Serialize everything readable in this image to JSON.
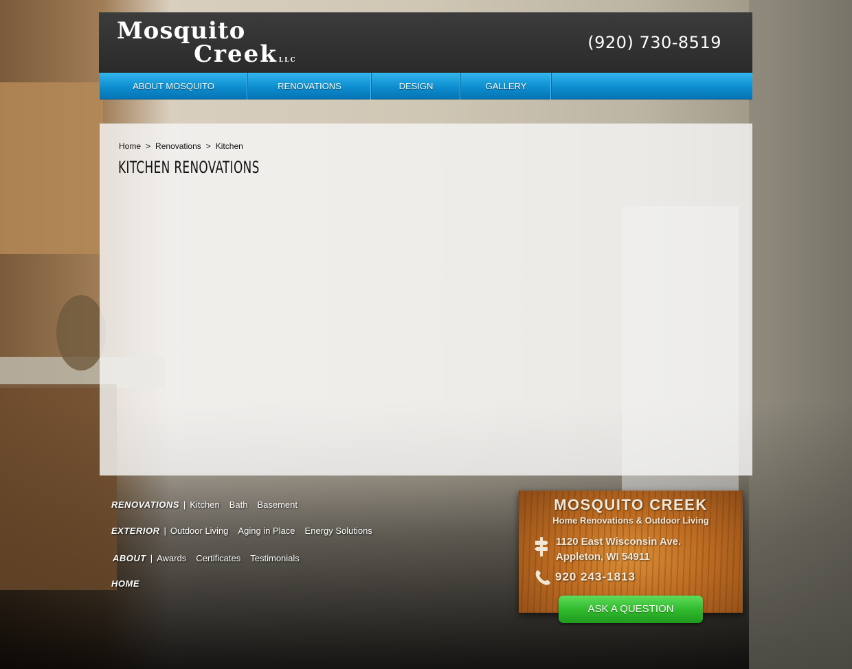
{
  "header": {
    "logo_line1": "Mosquito",
    "logo_line2": "Creek",
    "logo_llc": "LLC",
    "phone": "(920) 730-8519"
  },
  "nav": {
    "items": [
      {
        "label": "ABOUT MOSQUITO"
      },
      {
        "label": "RENOVATIONS"
      },
      {
        "label": "DESIGN"
      },
      {
        "label": "GALLERY"
      }
    ]
  },
  "breadcrumb": {
    "items": [
      "Home",
      "Renovations",
      "Kitchen"
    ],
    "separator": ">"
  },
  "page_title": "KITCHEN RENOVATIONS",
  "footer_links": {
    "renovations": {
      "heading": "RENOVATIONS",
      "links": [
        "Kitchen",
        "Bath",
        "Basement"
      ]
    },
    "exterior": {
      "heading": "EXTERIOR",
      "links": [
        "Outdoor Living",
        "Aging in Place",
        "Energy Solutions"
      ]
    },
    "about": {
      "heading": "ABOUT",
      "links": [
        "Awards",
        "Certificates",
        "Testimonials"
      ]
    },
    "home": {
      "heading": "HOME"
    },
    "separator": "|"
  },
  "contact_card": {
    "title": "MOSQUITO CREEK",
    "subtitle": "Home Renovations & Outdoor Living",
    "address_line1": "1120 East Wisconsin Ave.",
    "address_line2": "Appleton, WI 54911",
    "phone": "920 243-1813",
    "button_label": "ASK A QUESTION"
  },
  "colors": {
    "nav_blue": "#0d8dcf",
    "header_dark": "#2f2f2f",
    "button_green": "#2fb82b",
    "card_wood": "#c57628"
  }
}
